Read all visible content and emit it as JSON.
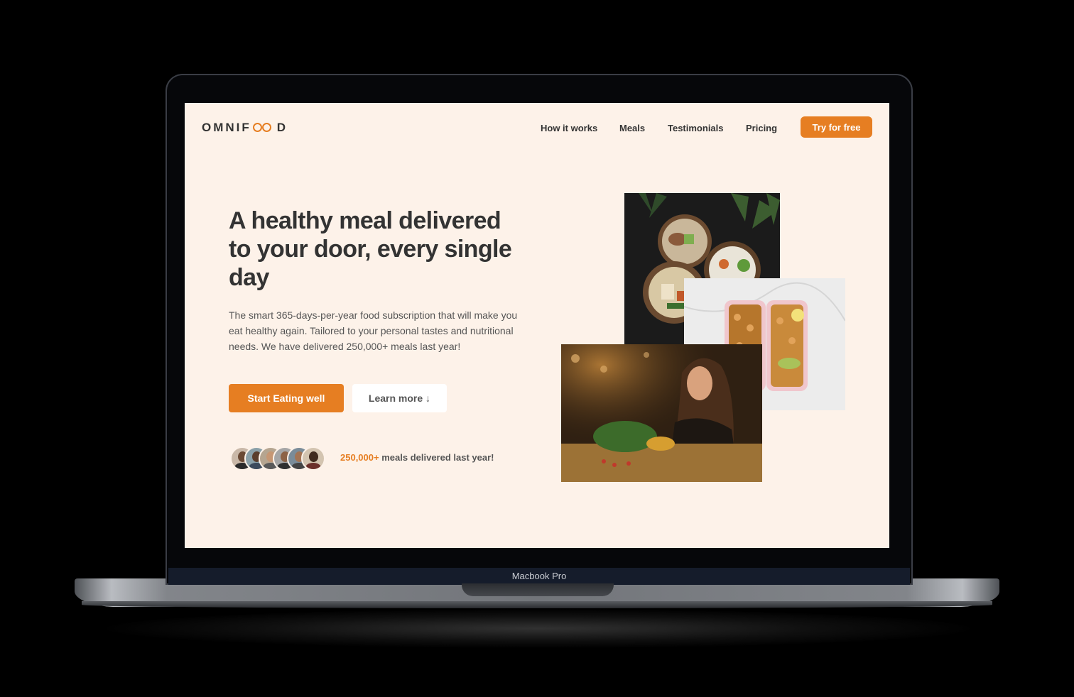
{
  "device": {
    "label": "Macbook Pro"
  },
  "header": {
    "logo": {
      "left": "OMNIF",
      "right": "D"
    },
    "nav": [
      "How it works",
      "Meals",
      "Testimonials",
      "Pricing"
    ],
    "cta_label": "Try for free"
  },
  "hero": {
    "headline": "A healthy meal delivered to your door, every single day",
    "description": "The smart 365-days-per-year food subscription that will make you eat healthy again. Tailored to your personal tastes and nutritional needs. We have delivered 250,000+ meals last year!",
    "primary_button": "Start Eating well",
    "secondary_button": "Learn more ↓",
    "delivered_count": "250,000+",
    "delivered_text": "meals delivered last year!"
  },
  "colors": {
    "accent": "#e67e22",
    "background": "#fdf2e9",
    "text": "#333333"
  }
}
